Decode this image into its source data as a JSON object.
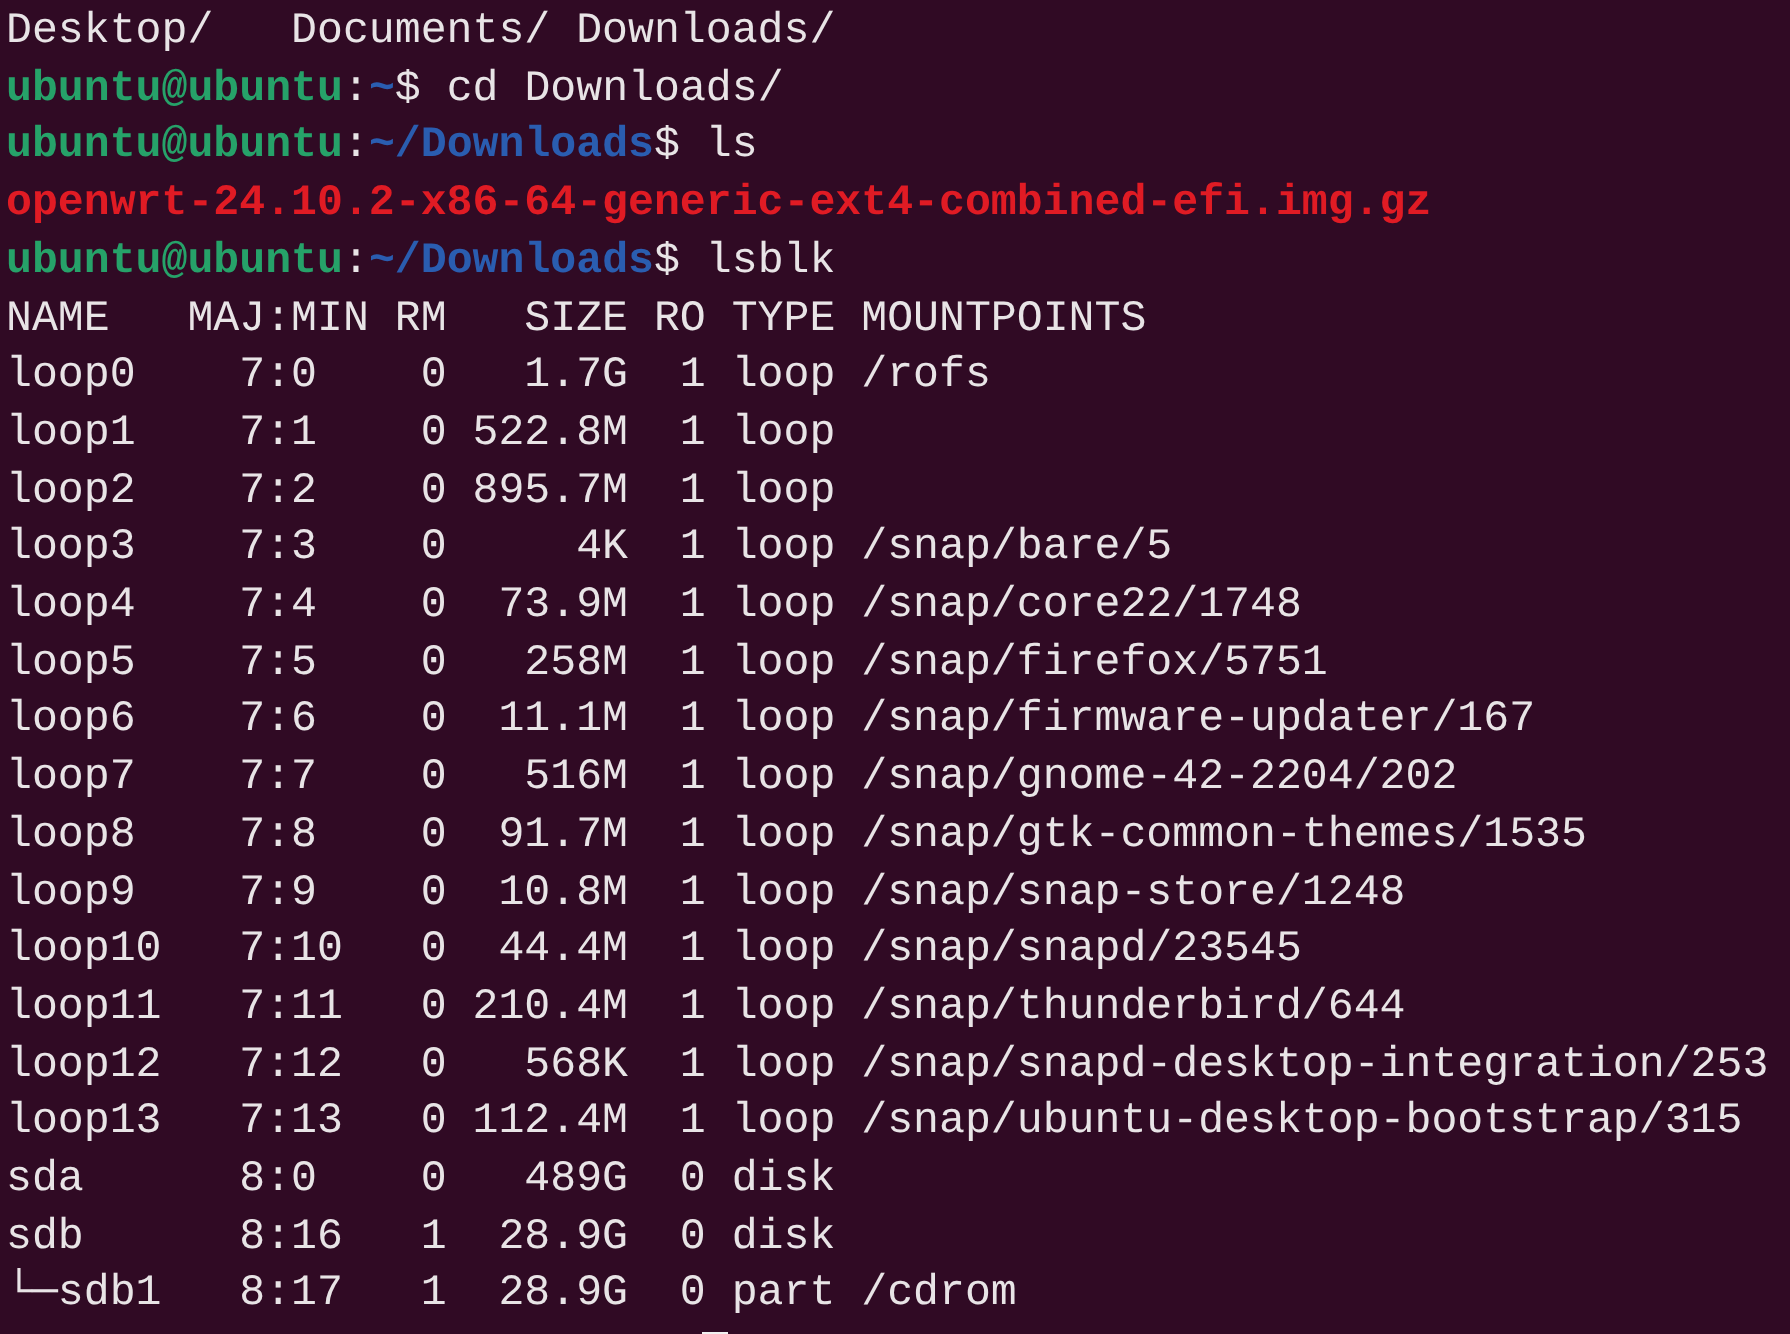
{
  "terminal": {
    "lines": [
      {
        "kind": "output",
        "text": "Desktop/   Documents/ Downloads/"
      },
      {
        "kind": "prompt",
        "user": "ubuntu@ubuntu",
        "separator": ":",
        "path": "~",
        "symbol": "$",
        "command": "cd Downloads/"
      },
      {
        "kind": "prompt",
        "user": "ubuntu@ubuntu",
        "separator": ":",
        "path": "~/Downloads",
        "symbol": "$",
        "command": "ls"
      },
      {
        "kind": "file",
        "text": "openwrt-24.10.2-x86-64-generic-ext4-combined-efi.img.gz"
      },
      {
        "kind": "prompt",
        "user": "ubuntu@ubuntu",
        "separator": ":",
        "path": "~/Downloads",
        "symbol": "$",
        "command": "lsblk"
      },
      {
        "kind": "output",
        "text": "NAME   MAJ:MIN RM   SIZE RO TYPE MOUNTPOINTS"
      },
      {
        "kind": "output",
        "text": "loop0    7:0    0   1.7G  1 loop /rofs"
      },
      {
        "kind": "output",
        "text": "loop1    7:1    0 522.8M  1 loop"
      },
      {
        "kind": "output",
        "text": "loop2    7:2    0 895.7M  1 loop"
      },
      {
        "kind": "output",
        "text": "loop3    7:3    0     4K  1 loop /snap/bare/5"
      },
      {
        "kind": "output",
        "text": "loop4    7:4    0  73.9M  1 loop /snap/core22/1748"
      },
      {
        "kind": "output",
        "text": "loop5    7:5    0   258M  1 loop /snap/firefox/5751"
      },
      {
        "kind": "output",
        "text": "loop6    7:6    0  11.1M  1 loop /snap/firmware-updater/167"
      },
      {
        "kind": "output",
        "text": "loop7    7:7    0   516M  1 loop /snap/gnome-42-2204/202"
      },
      {
        "kind": "output",
        "text": "loop8    7:8    0  91.7M  1 loop /snap/gtk-common-themes/1535"
      },
      {
        "kind": "output",
        "text": "loop9    7:9    0  10.8M  1 loop /snap/snap-store/1248"
      },
      {
        "kind": "output",
        "text": "loop10   7:10   0  44.4M  1 loop /snap/snapd/23545"
      },
      {
        "kind": "output",
        "text": "loop11   7:11   0 210.4M  1 loop /snap/thunderbird/644"
      },
      {
        "kind": "output",
        "text": "loop12   7:12   0   568K  1 loop /snap/snapd-desktop-integration/253"
      },
      {
        "kind": "output",
        "text": "loop13   7:13   0 112.4M  1 loop /snap/ubuntu-desktop-bootstrap/315"
      },
      {
        "kind": "output",
        "text": "sda      8:0    0   489G  0 disk"
      },
      {
        "kind": "output",
        "text": "sdb      8:16   1  28.9G  0 disk"
      },
      {
        "kind": "output",
        "text": "└─sdb1   8:17   1  28.9G  0 part /cdrom"
      },
      {
        "kind": "cursor"
      }
    ]
  }
}
